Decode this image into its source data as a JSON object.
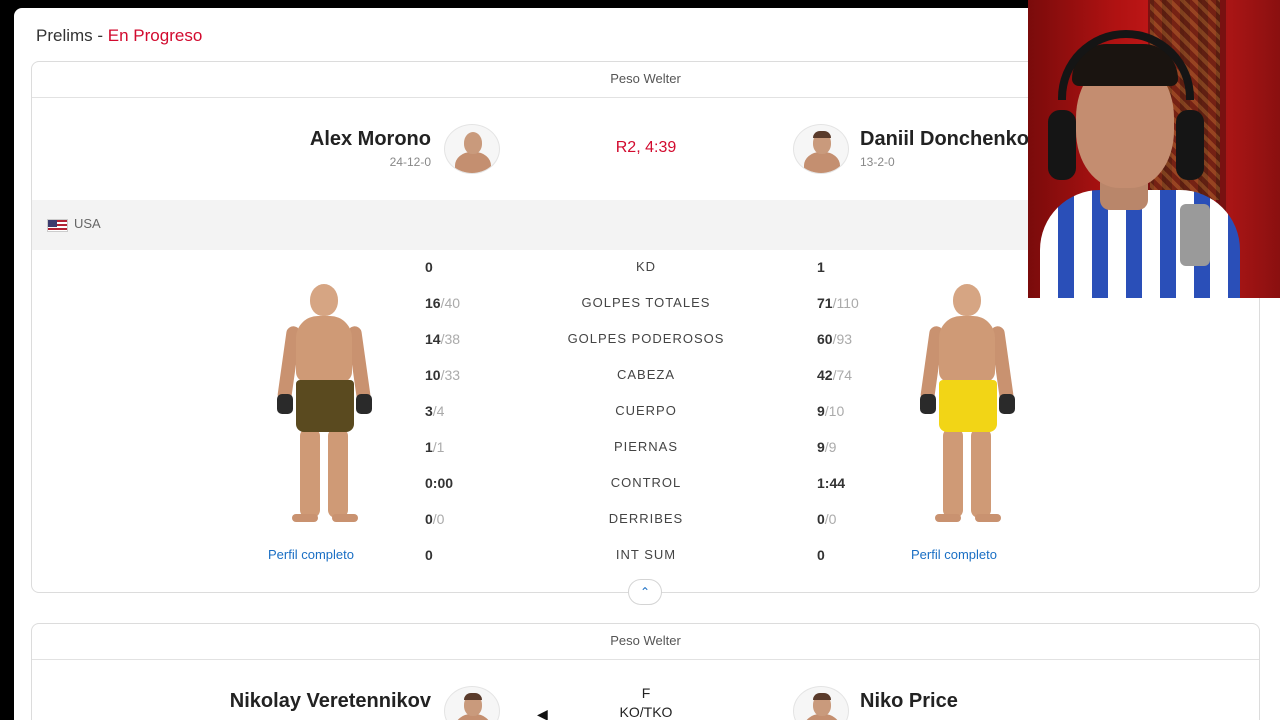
{
  "section": {
    "label": "Prelims",
    "separator": " - ",
    "status": "En Progreso"
  },
  "fight1": {
    "weight_class": "Peso Welter",
    "result": "R2, 4:39",
    "fighter_left": {
      "name": "Alex Morono",
      "record": "24-12-0",
      "country": "USA",
      "profile_link": "Perfil completo"
    },
    "fighter_right": {
      "name": "Daniil Donchenko",
      "record": "13-2-0",
      "profile_link": "Perfil completo"
    },
    "stats": [
      {
        "label": "KD",
        "left": "0",
        "left_total": "",
        "right": "1",
        "right_total": ""
      },
      {
        "label": "GOLPES TOTALES",
        "left": "16",
        "left_total": "/40",
        "right": "71",
        "right_total": "/110"
      },
      {
        "label": "GOLPES PODEROSOS",
        "left": "14",
        "left_total": "/38",
        "right": "60",
        "right_total": "/93"
      },
      {
        "label": "CABEZA",
        "left": "10",
        "left_total": "/33",
        "right": "42",
        "right_total": "/74"
      },
      {
        "label": "CUERPO",
        "left": "3",
        "left_total": "/4",
        "right": "9",
        "right_total": "/10"
      },
      {
        "label": "PIERNAS",
        "left": "1",
        "left_total": "/1",
        "right": "9",
        "right_total": "/9"
      },
      {
        "label": "CONTROL",
        "left": "0:00",
        "left_total": "",
        "right": "1:44",
        "right_total": ""
      },
      {
        "label": "DERRIBES",
        "left": "0",
        "left_total": "/0",
        "right": "0",
        "right_total": "/0"
      },
      {
        "label": "INT SUM",
        "left": "0",
        "left_total": "",
        "right": "0",
        "right_total": ""
      }
    ]
  },
  "fight2": {
    "weight_class": "Peso Welter",
    "result_line1": "F",
    "result_line2": "KO/TKO",
    "fighter_left": {
      "name": "Nikolay Veretennikov"
    },
    "fighter_right": {
      "name": "Niko Price"
    }
  },
  "colors": {
    "accent": "#d20a2e",
    "link": "#1a6fc4",
    "left_shorts": "#5a4a1f",
    "right_shorts": "#f2d516"
  },
  "icons": [
    "usa-flag-icon",
    "chevron-up-icon",
    "caret-left-icon"
  ]
}
